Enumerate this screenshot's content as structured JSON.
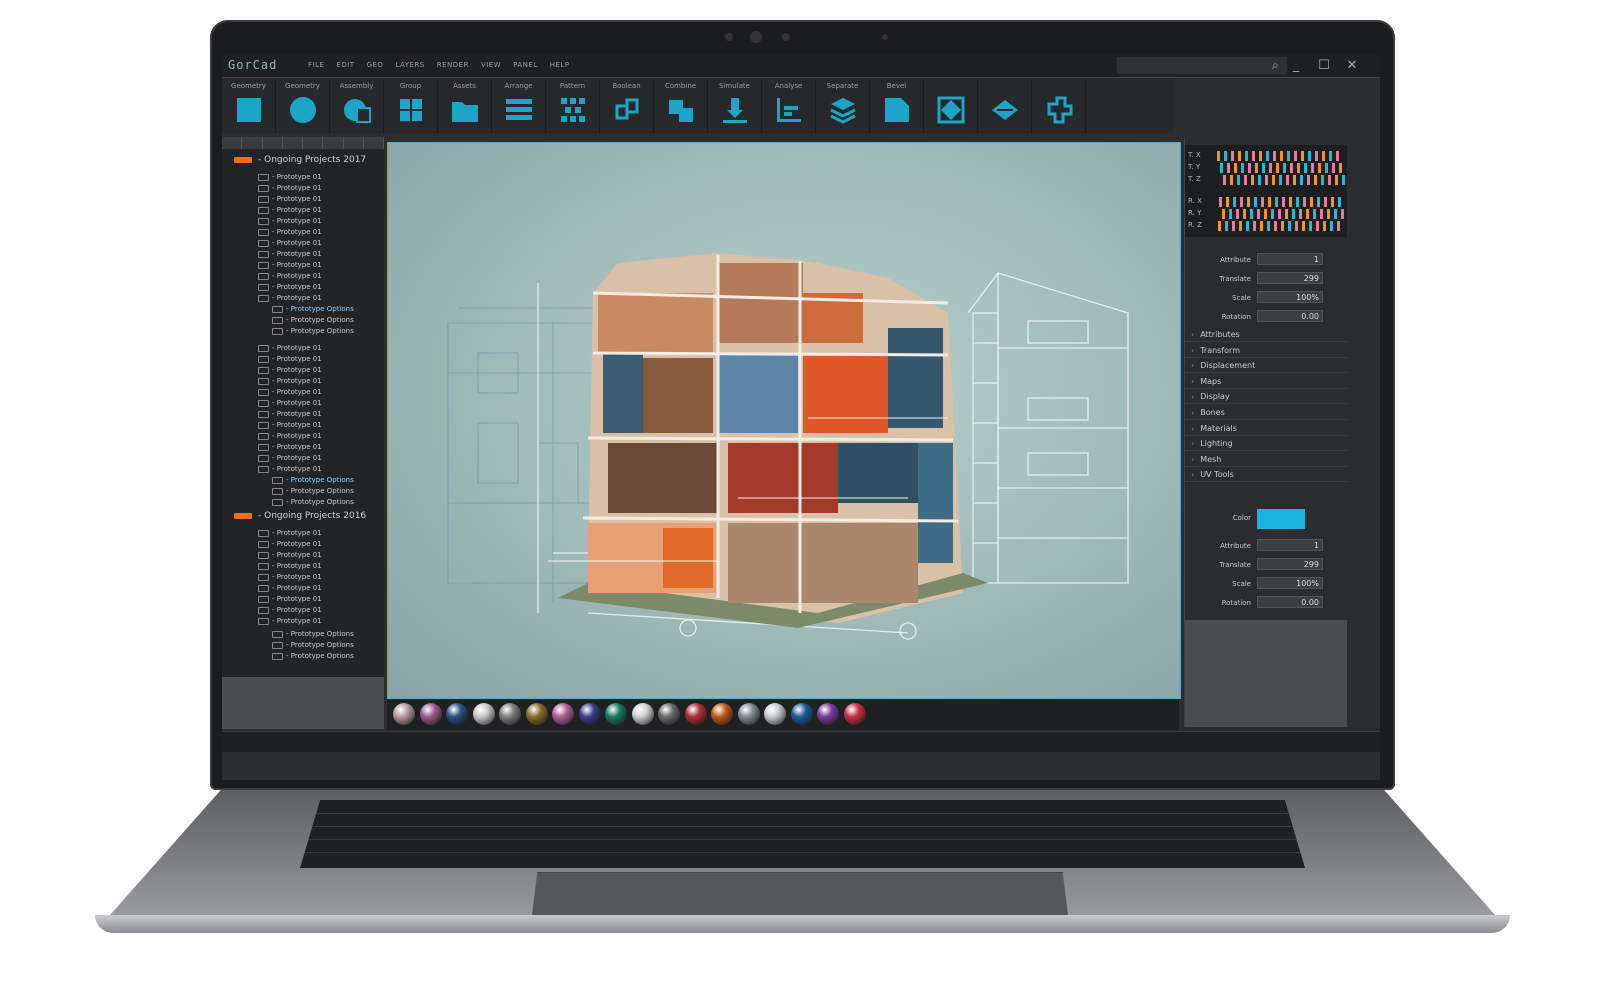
{
  "app": {
    "logo": "GorCad",
    "menu": [
      "FILE",
      "EDIT",
      "GEO",
      "LAYERS",
      "RENDER",
      "VIEW",
      "PANEL",
      "HELP"
    ]
  },
  "toolbar": {
    "tools": [
      {
        "label": "Geometry",
        "icon": "square-icon"
      },
      {
        "label": "Geometry",
        "icon": "circle-icon"
      },
      {
        "label": "Assembly",
        "icon": "assembly-icon"
      },
      {
        "label": "Group",
        "icon": "grid-icon"
      },
      {
        "label": "Assets",
        "icon": "folder-icon"
      },
      {
        "label": "Arrange",
        "icon": "lines-icon"
      },
      {
        "label": "Pattern",
        "icon": "pattern-icon"
      },
      {
        "label": "Boolean",
        "icon": "boolean-icon"
      },
      {
        "label": "Combine",
        "icon": "combine-icon"
      },
      {
        "label": "Simulate",
        "icon": "simulate-icon"
      },
      {
        "label": "Analyse",
        "icon": "chart-icon"
      },
      {
        "label": "Separate",
        "icon": "layers-icon"
      },
      {
        "label": "Bevel",
        "icon": "bevel-icon"
      },
      {
        "label": "",
        "icon": "diamond-icon"
      },
      {
        "label": "",
        "icon": "plane-icon"
      },
      {
        "label": "",
        "icon": "puzzle-icon"
      }
    ]
  },
  "tree": {
    "group1": "- Ongoing Projects 2017",
    "group2": "- Ongoing Projects 2016",
    "prototype": "- Prototype 01",
    "option": "- Prototype Options"
  },
  "timeline": {
    "rows": [
      "T. X",
      "T. Y",
      "T. Z",
      "R. X",
      "R. Y",
      "R. Z"
    ]
  },
  "props1": [
    {
      "label": "Attribute",
      "value": "1"
    },
    {
      "label": "Translate",
      "value": "299"
    },
    {
      "label": "Scale",
      "value": "100%"
    },
    {
      "label": "Rotation",
      "value": "0.00"
    }
  ],
  "accordion": [
    "Attributes",
    "Transform",
    "Displacement",
    "Maps",
    "Display",
    "Bones",
    "Materials",
    "Lighting",
    "Mesh",
    "UV Tools"
  ],
  "color": {
    "label": "Color",
    "value": "#1bb3e0"
  },
  "props2": [
    {
      "label": "Attribute",
      "value": "1"
    },
    {
      "label": "Translate",
      "value": "299"
    },
    {
      "label": "Scale",
      "value": "100%"
    },
    {
      "label": "Rotation",
      "value": "0.00"
    }
  ],
  "colors": {
    "accent": "#1ba6c9",
    "tag": "#ff6a13",
    "timeline_orange": "#f7941d",
    "timeline_cyan": "#2ab7d6",
    "timeline_pink": "#e87aa0"
  }
}
